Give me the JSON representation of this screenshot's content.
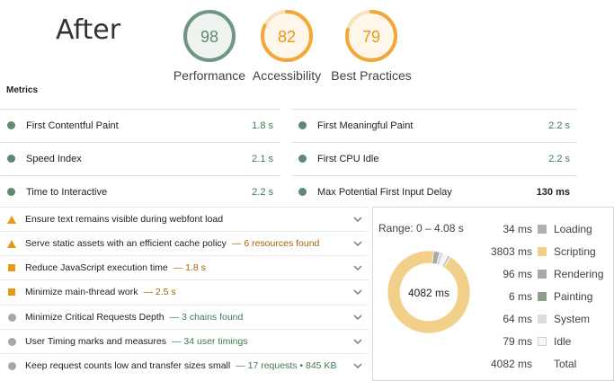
{
  "page_heading": "After",
  "gauges": [
    {
      "score": "98",
      "label": "Performance",
      "value": 0.98,
      "color": "#0c8c49",
      "ring_color": "#6f9584"
    },
    {
      "score": "82",
      "label": "Accessibility",
      "value": 0.82,
      "color": "#e69a16",
      "ring_color": "#f2a73a"
    },
    {
      "score": "79",
      "label": "Best Practices",
      "value": 0.79,
      "color": "#e69a16",
      "ring_color": "#f2a73a"
    }
  ],
  "metrics": {
    "title": "Metrics",
    "items": [
      {
        "name": "First Contentful Paint",
        "value": "1.8 s",
        "status": "green"
      },
      {
        "name": "First Meaningful Paint",
        "value": "2.2 s",
        "status": "black"
      },
      {
        "name": "Speed Index",
        "value": "2.1 s",
        "status": "black"
      },
      {
        "name": "First CPU Idle",
        "value": "2.2 s",
        "status": "black"
      },
      {
        "name": "Time to Interactive",
        "value": "2.2 s",
        "status": "black"
      },
      {
        "name": "Max Potential First Input Delay",
        "value": "130 ms",
        "status": "bold"
      }
    ]
  },
  "audits": [
    {
      "icon": "warning-triangle",
      "title": "Ensure text remains visible during webfont load",
      "detail": ""
    },
    {
      "icon": "warning-triangle",
      "title": "Serve static assets with an efficient cache policy",
      "detail": "— 6 resources found",
      "detail_color": "orange"
    },
    {
      "icon": "orange-square",
      "title": "Reduce JavaScript execution time",
      "detail": "— 1.8 s",
      "detail_color": "orange"
    },
    {
      "icon": "orange-square",
      "title": "Minimize main-thread work",
      "detail": "— 2.5 s",
      "detail_color": "orange"
    },
    {
      "icon": "grey-circle",
      "title": "Minimize Critical Requests Depth",
      "detail": "— 3 chains found",
      "detail_color": "green"
    },
    {
      "icon": "grey-circle",
      "title": "User Timing marks and measures",
      "detail": "— 34 user timings",
      "detail_color": "green"
    },
    {
      "icon": "grey-circle",
      "title": "Keep request counts low and transfer sizes small",
      "detail": "— 17 requests • 845 KB",
      "detail_color": "green"
    }
  ],
  "breakdown": {
    "range": "Range: 0 – 4.08 s",
    "center_label": "4082 ms",
    "rows": [
      {
        "ms": "34 ms",
        "category": "Loading",
        "value": 34,
        "color": "#b0b0b0"
      },
      {
        "ms": "3803 ms",
        "category": "Scripting",
        "value": 3803,
        "color": "#f2d08a"
      },
      {
        "ms": "96 ms",
        "category": "Rendering",
        "value": 96,
        "color": "#a9a9a9"
      },
      {
        "ms": "6 ms",
        "category": "Painting",
        "value": 6,
        "color": "#8a9e8a"
      },
      {
        "ms": "64 ms",
        "category": "System",
        "value": 64,
        "color": "#dcdcdc"
      },
      {
        "ms": "79 ms",
        "category": "Idle",
        "value": 79,
        "color": "#f6f6f6"
      }
    ],
    "total_ms": "4082 ms",
    "total_label": "Total"
  }
}
